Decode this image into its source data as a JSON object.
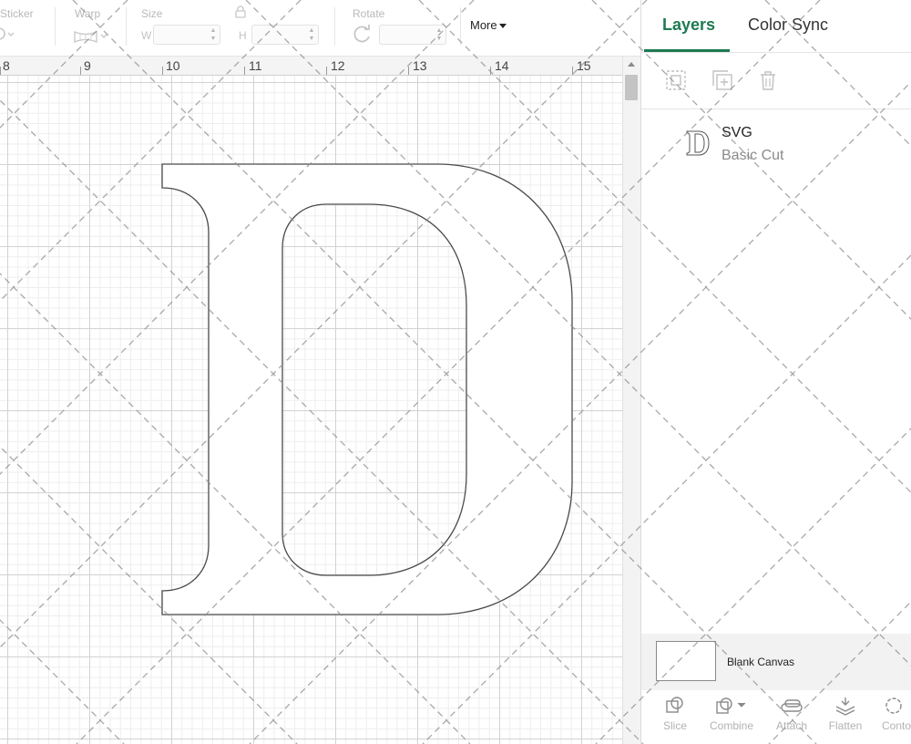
{
  "toolbar": {
    "sticker_label": "Sticker",
    "warp_label": "Warp",
    "size_label": "Size",
    "width_prefix": "W",
    "height_prefix": "H",
    "rotate_label": "Rotate",
    "more_label": "More",
    "icons": [
      "sticker-icon",
      "warp-icon",
      "lock-icon",
      "rotate-icon"
    ]
  },
  "ruler": {
    "numbers": [
      "8",
      "9",
      "10",
      "11",
      "12",
      "13",
      "14",
      "15"
    ]
  },
  "panel": {
    "tabs": [
      {
        "label": "Layers",
        "active": true
      },
      {
        "label": "Color Sync",
        "active": false
      }
    ],
    "accent_color": "#1e7a52",
    "tool_icons": [
      "group-icon",
      "duplicate-icon",
      "delete-icon"
    ],
    "layer": {
      "title": "SVG",
      "subtitle": "Basic Cut",
      "thumb_icon": "letter-d-icon"
    },
    "blank_canvas_label": "Blank Canvas",
    "bottom_tools": [
      {
        "label": "Slice",
        "icon": "slice-icon"
      },
      {
        "label": "Combine",
        "icon": "combine-icon"
      },
      {
        "label": "Attach",
        "icon": "attach-icon"
      },
      {
        "label": "Flatten",
        "icon": "flatten-icon"
      },
      {
        "label": "Conto",
        "icon": "contour-icon"
      }
    ]
  }
}
